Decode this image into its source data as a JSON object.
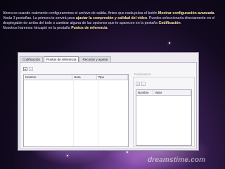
{
  "instructions": {
    "p1_text": "Ahora es cuando realmente configuraremos el archivo de salida. Antes que nada pulsa el botón ",
    "p1_bold": "Mostrar configuración avanzada",
    "p2_text": "Verás 3 pestañas. La primera te servirá para ",
    "p2_bold": "ajustar la compresión y calidad del video",
    "p2_tail": ". Puedes seleccionarla directamente en el desplegable de arriba del todo o cambiar alguna de las opciones que te aparecen en la pestaña ",
    "p2_bold2": "Codificación",
    "p3_text": "Nosotros haremos hincapié en la pestaña ",
    "p3_bold": "Puntos de referencia"
  },
  "tabs": [
    "Codificación",
    "Puntos de referencia",
    "Recortar y ajustar"
  ],
  "toolbar": {
    "add": "+",
    "remove": "−"
  },
  "markers_table": {
    "headers": [
      "Nombre",
      "Hora",
      "Tipo"
    ]
  },
  "parameters": {
    "title": "Parámetros",
    "headers": [
      "Nombre",
      "Valor"
    ]
  },
  "watermark": "dreamstime.com"
}
